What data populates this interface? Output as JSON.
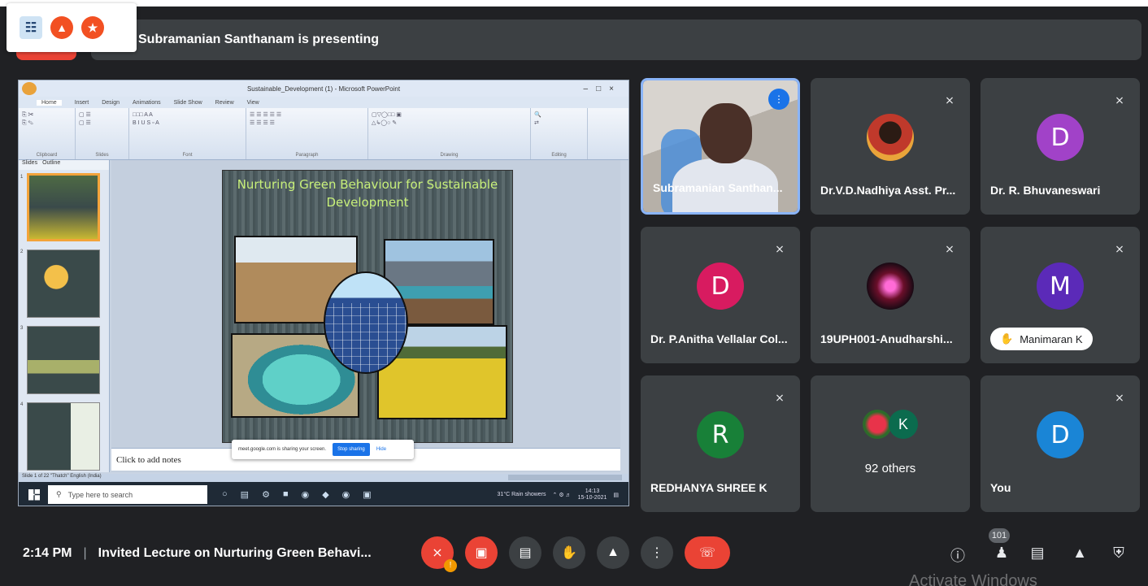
{
  "presenting_banner": "Subramanian Santhanam is presenting",
  "powerpoint": {
    "window_title": "Sustainable_Development (1) - Microsoft PowerPoint",
    "tabs": [
      "Home",
      "Insert",
      "Design",
      "Animations",
      "Slide Show",
      "Review",
      "View"
    ],
    "ribbon_groups": [
      "Clipboard",
      "Slides",
      "Font",
      "Paragraph",
      "Drawing",
      "Editing"
    ],
    "pane_tabs": [
      "Slides",
      "Outline"
    ],
    "slide_title": "Nurturing Green Behaviour for Sustainable Development",
    "notes_placeholder": "Click to add notes",
    "status_text": "Slide 1 of 22   \"Thatch\"   English (India)",
    "thumb_numbers": [
      "1",
      "2",
      "3",
      "4"
    ]
  },
  "share_popup": {
    "message": "meet.google.com is sharing your screen.",
    "stop_label": "Stop sharing",
    "hide_label": "Hide"
  },
  "taskbar": {
    "search_placeholder": "Type here to search",
    "weather": "31°C  Rain showers",
    "time": "14:13",
    "date": "15-10-2021"
  },
  "participants": [
    {
      "name": "Subramanian Santhan...",
      "speaking": true
    },
    {
      "name": "Dr.V.D.Nadhiya Asst. Pr...",
      "muted": true
    },
    {
      "name": "Dr. R. Bhuvaneswari",
      "initial": "D",
      "color": "#a142c8",
      "muted": true
    },
    {
      "name": "Dr. P.Anitha Vellalar Col...",
      "initial": "D",
      "color": "#d81b60",
      "muted": true
    },
    {
      "name": "19UPH001-Anudharshi...",
      "muted": true
    },
    {
      "name": "Manimaran K",
      "initial": "M",
      "color": "#5b2ab8",
      "muted": true,
      "hand_raised": true
    },
    {
      "name": "REDHANYA SHREE K",
      "initial": "R",
      "color": "#188038",
      "muted": true
    },
    {
      "name": "92 others",
      "chip_initial": "K",
      "chip_color": "#0b6b4e"
    },
    {
      "name": "You",
      "initial": "D",
      "color": "#1a85d6",
      "muted": true
    }
  ],
  "bottom_bar": {
    "time": "2:14 PM",
    "separator": "|",
    "meeting_title": "Invited Lecture on Nurturing Green Behavi...",
    "participant_count": "101"
  },
  "watermark": "Activate Windows",
  "colors": {
    "accent": "#1a73e8",
    "danger": "#ea4335",
    "tile_bg": "#3c4043",
    "bg": "#202124"
  }
}
